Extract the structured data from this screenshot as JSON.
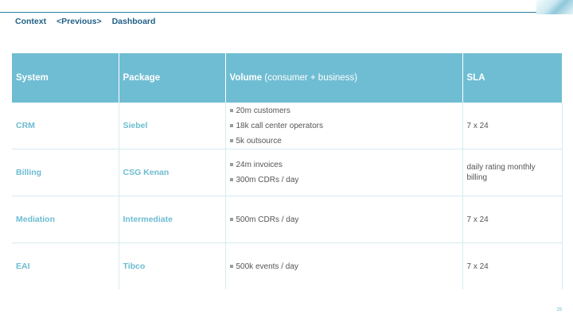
{
  "breadcrumb": {
    "items": [
      "Context",
      "<Previous>",
      "Dashboard"
    ]
  },
  "table": {
    "headers": {
      "system": "System",
      "package": "Package",
      "volume_main": "Volume",
      "volume_note": " (consumer + business)",
      "sla": "SLA"
    },
    "rows": [
      {
        "system": "CRM",
        "package": "Siebel",
        "volume": [
          "20m customers",
          "18k call center operators",
          "5k outsource"
        ],
        "sla": "7 x 24"
      },
      {
        "system": "Billing",
        "package": "CSG Kenan",
        "volume": [
          "24m invoices",
          "300m CDRs / day"
        ],
        "sla": "daily rating monthly billing"
      },
      {
        "system": "Mediation",
        "package": "Intermediate",
        "volume": [
          "500m CDRs / day"
        ],
        "sla": "7 x 24"
      },
      {
        "system": "EAI",
        "package": "Tibco",
        "volume": [
          "500k events / day"
        ],
        "sla": "7 x 24"
      }
    ]
  },
  "page_number": "29",
  "colors": {
    "header_bg": "#6fbdd3",
    "accent": "#6cbcd2",
    "breadcrumb": "#1f5f86"
  }
}
